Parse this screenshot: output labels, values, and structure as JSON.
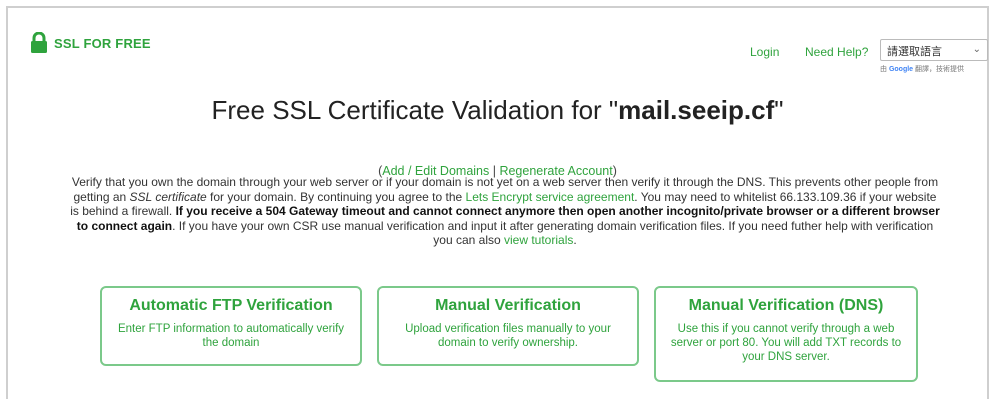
{
  "header": {
    "logo_text": "SSL FOR FREE",
    "nav_login": "Login",
    "nav_help": "Need Help?",
    "language_select": "請選取語言",
    "powered_prefix": "由",
    "powered_brand": "Google",
    "powered_suffix": "翻譯，技術提供"
  },
  "main": {
    "title_prefix": "Free SSL Certificate Validation for \"",
    "title_domain": "mail.seeip.cf",
    "title_suffix": "\"",
    "links": {
      "open": "(",
      "add_edit": "Add / Edit Domains",
      "sep": " | ",
      "regenerate": "Regenerate Account",
      "close": ")"
    },
    "description": {
      "p1": "Verify that you own the domain through your web server or if your domain is not yet on a web server then verify it through the DNS. This prevents other people from getting an ",
      "ssl_cert": "SSL certificate",
      "p2": " for your domain. By continuing you agree to the ",
      "le_link": "Lets Encrypt service agreement",
      "p3": ". You may need to whitelist 66.133.109.36 if your website is behind a firewall. ",
      "bold": "If you receive a 504 Gateway timeout and cannot connect anymore then open another incognito/private browser or a different browser to connect again",
      "p4": ". If you have your own CSR use manual verification and input it after generating domain verification files. If you need futher help with verification you can also ",
      "tutorials_link": "view tutorials",
      "p5": "."
    },
    "cards": [
      {
        "title": "Automatic FTP Verification",
        "desc": "Enter FTP information to automatically verify the domain"
      },
      {
        "title": "Manual Verification",
        "desc": "Upload verification files manually to your domain to verify ownership."
      },
      {
        "title": "Manual Verification (DNS)",
        "desc": "Use this if you cannot verify through a web server or port 80. You will add TXT records to your DNS server."
      }
    ]
  },
  "colors": {
    "accent": "#2fa33d",
    "card_border": "#7bc98a"
  },
  "icons": {
    "logo": "padlock-icon",
    "select": "chevron-down-icon"
  }
}
